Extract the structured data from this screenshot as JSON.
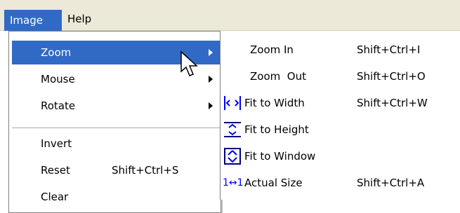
{
  "menubar": {
    "items": [
      {
        "label": "Image"
      },
      {
        "label": "Help"
      }
    ]
  },
  "image_menu": {
    "items": [
      {
        "label": "Zoom",
        "shortcut": "",
        "submenu": true
      },
      {
        "label": "Mouse",
        "shortcut": "",
        "submenu": true
      },
      {
        "label": "Rotate",
        "shortcut": "",
        "submenu": true
      },
      {
        "label": "Invert",
        "shortcut": ""
      },
      {
        "label": "Reset",
        "shortcut": "Shift+Ctrl+S"
      },
      {
        "label": "Clear",
        "shortcut": ""
      }
    ]
  },
  "zoom_submenu": {
    "items": [
      {
        "label": "Zoom In",
        "shortcut": "Shift+Ctrl+I",
        "icon": ""
      },
      {
        "label": "Zoom  Out",
        "shortcut": "Shift+Ctrl+O",
        "icon": ""
      },
      {
        "label": "Fit to Width",
        "shortcut": "Shift+Ctrl+W",
        "icon": "fit-width-icon"
      },
      {
        "label": "Fit to Height",
        "shortcut": "",
        "icon": "fit-height-icon"
      },
      {
        "label": "Fit to Window",
        "shortcut": "",
        "icon": "fit-window-icon"
      },
      {
        "label": "Actual Size",
        "shortcut": "Shift+Ctrl+A",
        "icon": "actual-size-icon",
        "icon_text": "1↔1"
      }
    ]
  },
  "colors": {
    "highlight": "#316ac5",
    "menubar_bg": "#ece9d8",
    "icon_blue": "#0000ff"
  }
}
